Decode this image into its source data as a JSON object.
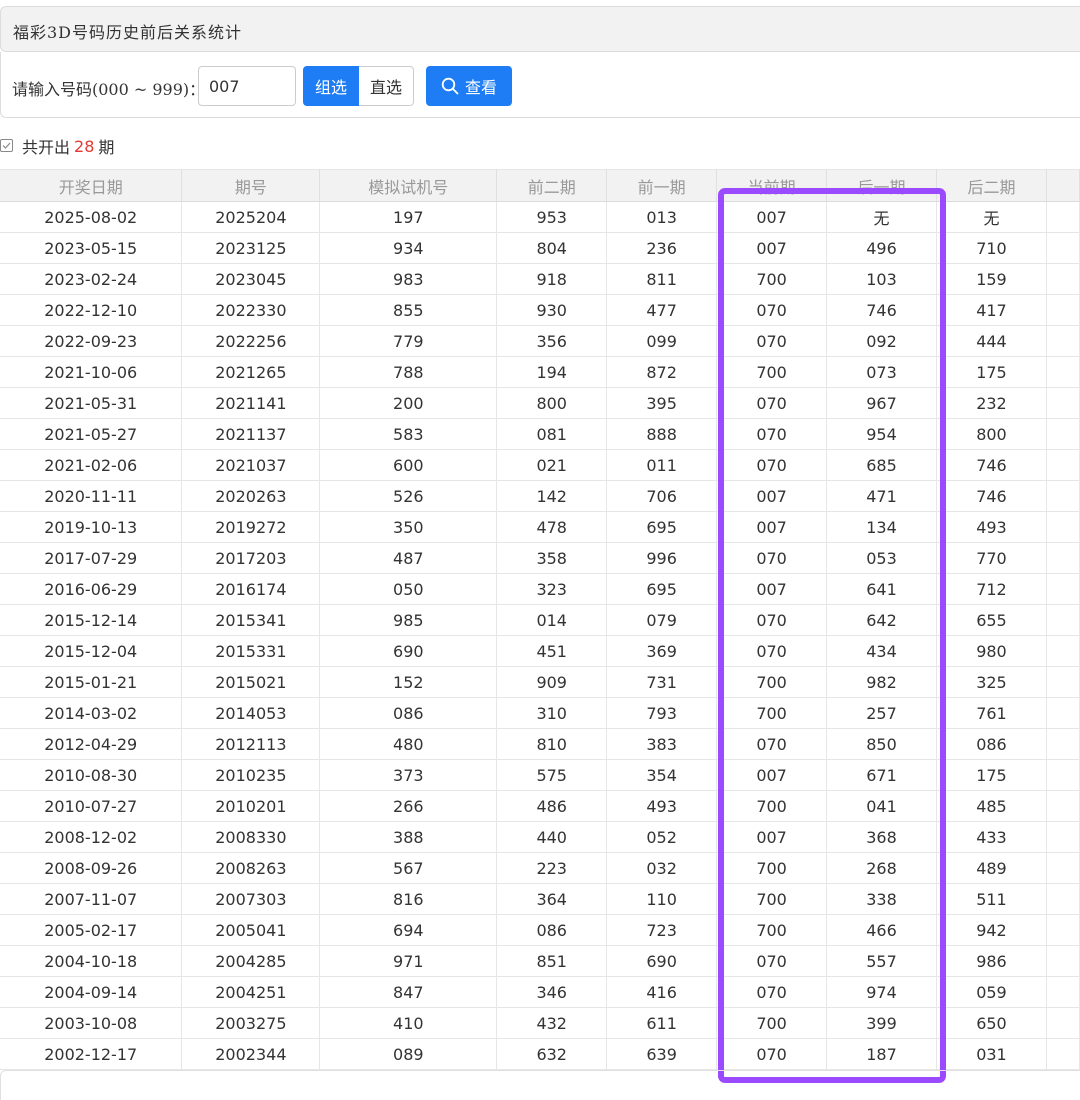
{
  "panel": {
    "title": "福彩3D号码历史前后关系统计"
  },
  "query": {
    "prompt_label": "请输入号码(000 ~ 999)：",
    "input_value": "007",
    "seg_group": "组选",
    "seg_direct": "直选",
    "view_button": "查看"
  },
  "summary": {
    "prefix": "共开出",
    "count": "28",
    "suffix": "期"
  },
  "table": {
    "columns": [
      "开奖日期",
      "期号",
      "模拟试机号",
      "前二期",
      "前一期",
      "当前期",
      "后一期",
      "后二期"
    ],
    "rows": [
      [
        "2025-08-02",
        "2025204",
        "197",
        "953",
        "013",
        "007",
        "无",
        "无"
      ],
      [
        "2023-05-15",
        "2023125",
        "934",
        "804",
        "236",
        "007",
        "496",
        "710"
      ],
      [
        "2023-02-24",
        "2023045",
        "983",
        "918",
        "811",
        "700",
        "103",
        "159"
      ],
      [
        "2022-12-10",
        "2022330",
        "855",
        "930",
        "477",
        "070",
        "746",
        "417"
      ],
      [
        "2022-09-23",
        "2022256",
        "779",
        "356",
        "099",
        "070",
        "092",
        "444"
      ],
      [
        "2021-10-06",
        "2021265",
        "788",
        "194",
        "872",
        "700",
        "073",
        "175"
      ],
      [
        "2021-05-31",
        "2021141",
        "200",
        "800",
        "395",
        "070",
        "967",
        "232"
      ],
      [
        "2021-05-27",
        "2021137",
        "583",
        "081",
        "888",
        "070",
        "954",
        "800"
      ],
      [
        "2021-02-06",
        "2021037",
        "600",
        "021",
        "011",
        "070",
        "685",
        "746"
      ],
      [
        "2020-11-11",
        "2020263",
        "526",
        "142",
        "706",
        "007",
        "471",
        "746"
      ],
      [
        "2019-10-13",
        "2019272",
        "350",
        "478",
        "695",
        "007",
        "134",
        "493"
      ],
      [
        "2017-07-29",
        "2017203",
        "487",
        "358",
        "996",
        "070",
        "053",
        "770"
      ],
      [
        "2016-06-29",
        "2016174",
        "050",
        "323",
        "695",
        "007",
        "641",
        "712"
      ],
      [
        "2015-12-14",
        "2015341",
        "985",
        "014",
        "079",
        "070",
        "642",
        "655"
      ],
      [
        "2015-12-04",
        "2015331",
        "690",
        "451",
        "369",
        "070",
        "434",
        "980"
      ],
      [
        "2015-01-21",
        "2015021",
        "152",
        "909",
        "731",
        "700",
        "982",
        "325"
      ],
      [
        "2014-03-02",
        "2014053",
        "086",
        "310",
        "793",
        "700",
        "257",
        "761"
      ],
      [
        "2012-04-29",
        "2012113",
        "480",
        "810",
        "383",
        "070",
        "850",
        "086"
      ],
      [
        "2010-08-30",
        "2010235",
        "373",
        "575",
        "354",
        "007",
        "671",
        "175"
      ],
      [
        "2010-07-27",
        "2010201",
        "266",
        "486",
        "493",
        "700",
        "041",
        "485"
      ],
      [
        "2008-12-02",
        "2008330",
        "388",
        "440",
        "052",
        "007",
        "368",
        "433"
      ],
      [
        "2008-09-26",
        "2008263",
        "567",
        "223",
        "032",
        "700",
        "268",
        "489"
      ],
      [
        "2007-11-07",
        "2007303",
        "816",
        "364",
        "110",
        "700",
        "338",
        "511"
      ],
      [
        "2005-02-17",
        "2005041",
        "694",
        "086",
        "723",
        "700",
        "466",
        "942"
      ],
      [
        "2004-10-18",
        "2004285",
        "971",
        "851",
        "690",
        "070",
        "557",
        "986"
      ],
      [
        "2004-09-14",
        "2004251",
        "847",
        "346",
        "416",
        "070",
        "974",
        "059"
      ],
      [
        "2003-10-08",
        "2003275",
        "410",
        "432",
        "611",
        "700",
        "399",
        "650"
      ],
      [
        "2002-12-17",
        "2002344",
        "089",
        "632",
        "639",
        "070",
        "187",
        "031"
      ]
    ]
  },
  "colors": {
    "accent": "#1e7cf5",
    "highlight": "#9b4bff",
    "count": "#e53935"
  }
}
